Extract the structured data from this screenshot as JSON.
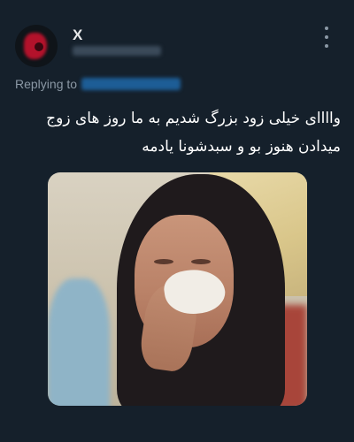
{
  "author": {
    "display_name": "X"
  },
  "reply": {
    "label": "Replying to"
  },
  "tweet": {
    "text": "واااای خیلی زود بزرگ شدیم به ما روز های زوج میدادن هنوز بو و سبدشونا یادمه"
  },
  "icons": {
    "more": "more-vertical-icon"
  },
  "colors": {
    "background": "#15202b",
    "text": "#ffffff",
    "secondary": "#8b98a5",
    "link": "#1d9bf0"
  }
}
